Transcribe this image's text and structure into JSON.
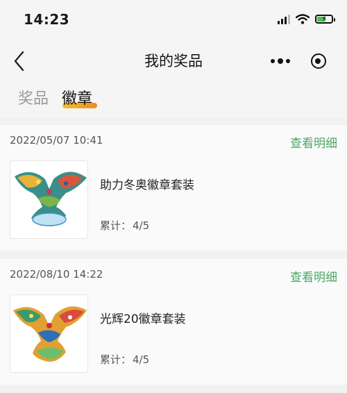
{
  "status_bar": {
    "time": "14:23",
    "icons": [
      "signal-icon",
      "wifi-icon",
      "battery-charging-icon"
    ]
  },
  "nav": {
    "title": "我的奖品",
    "back_icon": "chevron-left-icon",
    "more_icon": "more-dots-icon",
    "close_icon": "target-circle-icon"
  },
  "tabs": [
    {
      "label": "奖品",
      "active": false
    },
    {
      "label": "徽章",
      "active": true
    }
  ],
  "colors": {
    "accent_green": "#4ba864",
    "tab_underline": "#f6c02b",
    "page_bg": "#f1f1f1"
  },
  "cards": [
    {
      "date": "2022/05/07 10:41",
      "detail_label": "查看明细",
      "name": "助力冬奥徽章套装",
      "count_label": "累计：",
      "count_value": "4/5",
      "image_icon": "bird-badge-icon"
    },
    {
      "date": "2022/08/10 14:22",
      "detail_label": "查看明细",
      "name": "光辉20徽章套装",
      "count_label": "累计：",
      "count_value": "4/5",
      "image_icon": "bird-badge-icon"
    }
  ]
}
